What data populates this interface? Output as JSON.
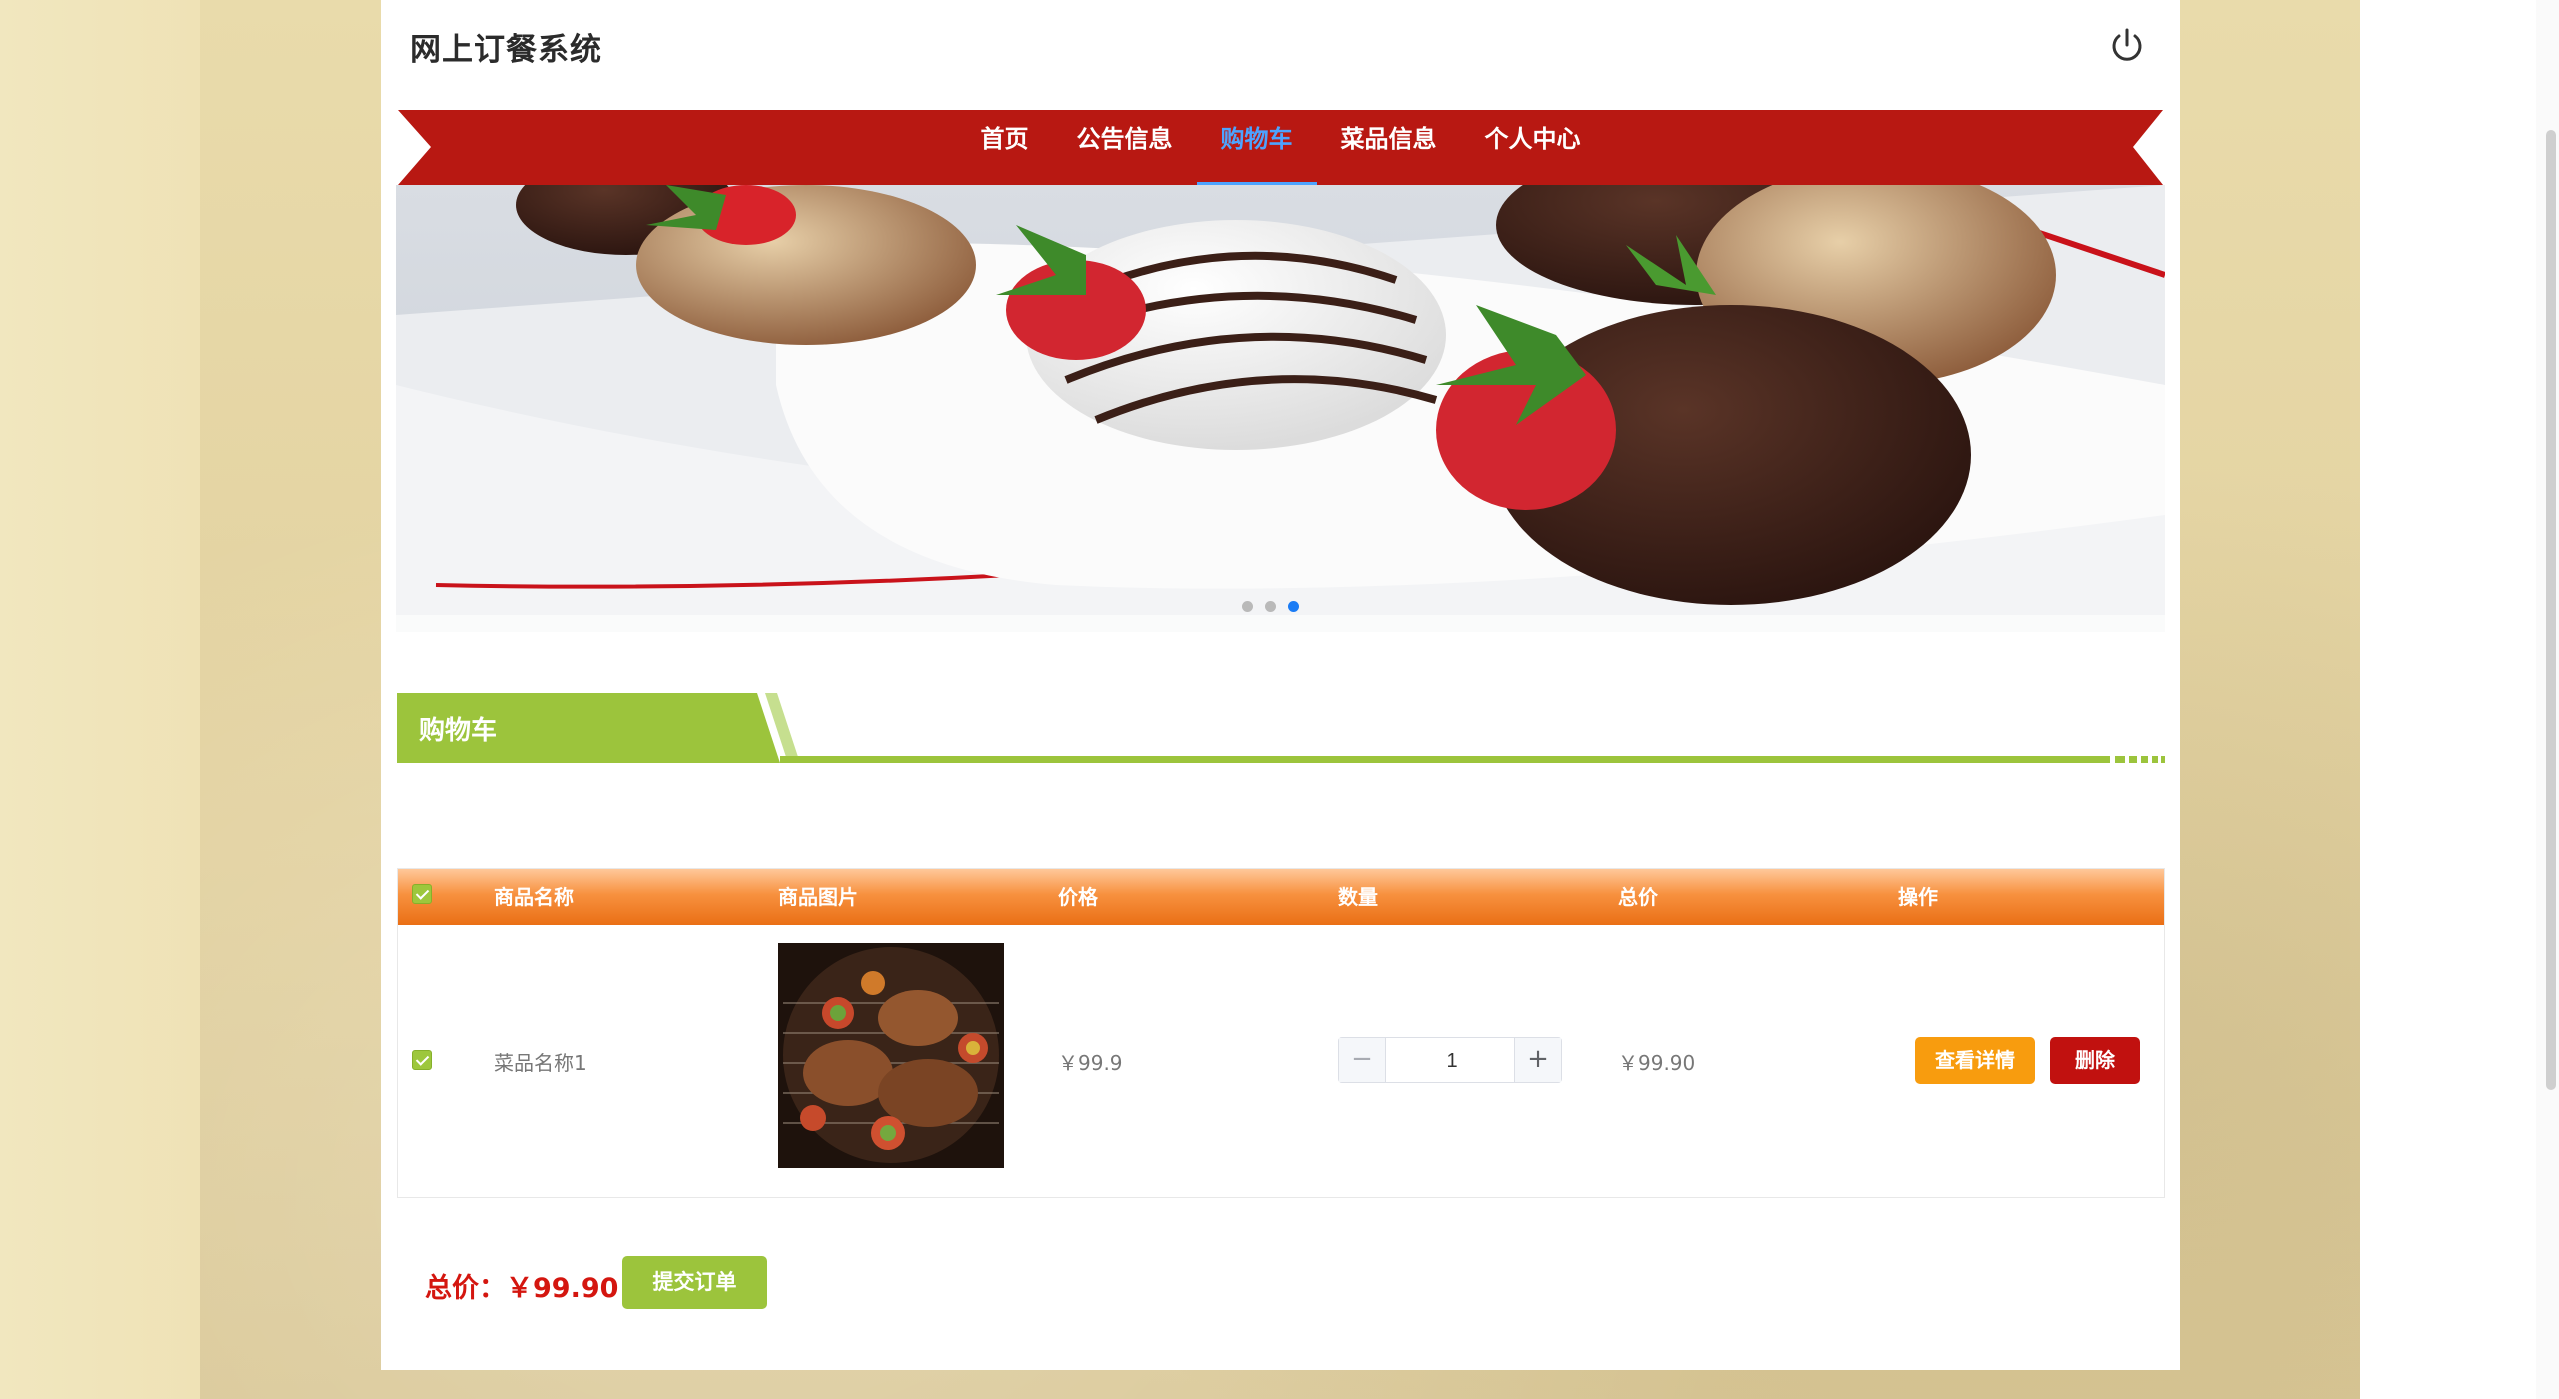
{
  "header": {
    "site_title": "网上订餐系统",
    "power_icon": "power-icon"
  },
  "nav": {
    "items": [
      {
        "label": "首页",
        "active": false
      },
      {
        "label": "公告信息",
        "active": false
      },
      {
        "label": "购物车",
        "active": true
      },
      {
        "label": "菜品信息",
        "active": false
      },
      {
        "label": "个人中心",
        "active": false
      }
    ]
  },
  "banner": {
    "slide_count": 3,
    "active_slide": 3
  },
  "section": {
    "title": "购物车"
  },
  "cart": {
    "headers": {
      "name": "商品名称",
      "image": "商品图片",
      "price": "价格",
      "quantity": "数量",
      "total": "总价",
      "actions": "操作"
    },
    "rows": [
      {
        "checked": true,
        "name": "菜品名称1",
        "price": "￥99.9",
        "quantity": "1",
        "total": "￥99.90",
        "detail_label": "查看详情",
        "delete_label": "删除"
      }
    ]
  },
  "footer": {
    "total_label": "总价：￥99.90",
    "submit_label": "提交订单"
  },
  "colors": {
    "nav_red": "#b81812",
    "active_nav": "#4da3ff",
    "section_green": "#9cc43c",
    "header_orange": "#f7913f",
    "detail_orange": "#f89c0e",
    "delete_red": "#c1110f",
    "total_red": "#d4160f"
  }
}
